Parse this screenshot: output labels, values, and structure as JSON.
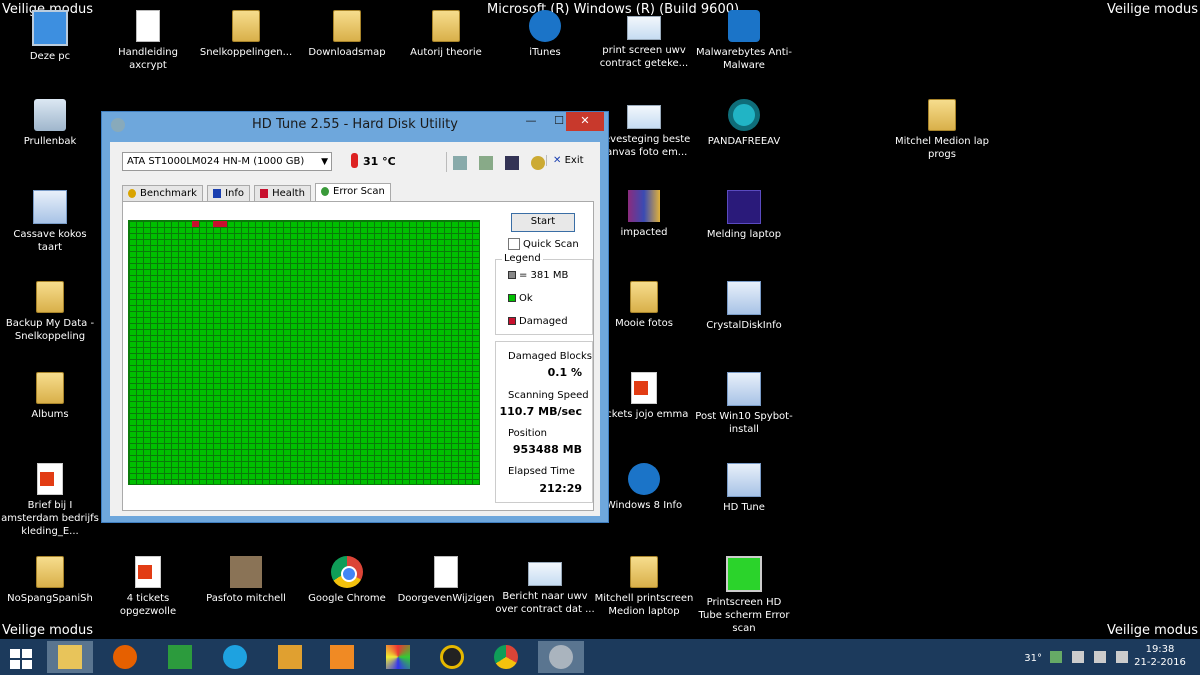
{
  "desktop": {
    "safe_mode_label": "Veilige modus",
    "build_text": "Microsoft (R) Windows (R) (Build 9600)",
    "icons": [
      {
        "label": "Deze pc",
        "icon": "pc-icon"
      },
      {
        "label": "Handleiding axcrypt",
        "icon": "document-icon"
      },
      {
        "label": "Snelkoppelingen...",
        "icon": "folder-icon"
      },
      {
        "label": "Downloadsmap",
        "icon": "folder-icon"
      },
      {
        "label": "Autorij theorie",
        "icon": "folder-icon"
      },
      {
        "label": "iTunes",
        "icon": "itunes-icon"
      },
      {
        "label": "print screen uwv contract geteke...",
        "icon": "screenshot-icon"
      },
      {
        "label": "Malwarebytes Anti-Malware",
        "icon": "malwarebytes-icon"
      },
      {
        "label": "Prullenbak",
        "icon": "recycle-bin-icon"
      },
      {
        "label": "Cassave kokos taart",
        "icon": "document-icon"
      },
      {
        "label": "Backup My Data - Snelkoppeling",
        "icon": "folder-icon"
      },
      {
        "label": "Albums",
        "icon": "folder-icon"
      },
      {
        "label": "Brief bij I amsterdam bedrijfs kleding_E...",
        "icon": "pdf-icon"
      },
      {
        "label": "bevesteging beste canvas foto em...",
        "icon": "screenshot-icon"
      },
      {
        "label": "impacted",
        "icon": "winrar-icon"
      },
      {
        "label": "Mooie fotos",
        "icon": "folder-icon"
      },
      {
        "label": "tickets jojo emma",
        "icon": "pdf-icon"
      },
      {
        "label": "Windows 8 Info",
        "icon": "info-icon"
      },
      {
        "label": "PANDAFREEAV",
        "icon": "panda-icon"
      },
      {
        "label": "Melding laptop",
        "icon": "document-icon"
      },
      {
        "label": "CrystalDiskInfo",
        "icon": "crystaldisk-icon"
      },
      {
        "label": "Post Win10 Spybot-install",
        "icon": "spybot-icon"
      },
      {
        "label": "HD Tune",
        "icon": "hdtune-icon"
      },
      {
        "label": "Mitchel Medion lap progs",
        "icon": "folder-icon"
      },
      {
        "label": "NoSpangSpaniSh",
        "icon": "folder-icon"
      },
      {
        "label": "4 tickets opgezwolle",
        "icon": "pdf-icon"
      },
      {
        "label": "Pasfoto mitchell",
        "icon": "photo-icon"
      },
      {
        "label": "Google Chrome",
        "icon": "chrome-icon"
      },
      {
        "label": "DoorgevenWijzigen",
        "icon": "document-icon"
      },
      {
        "label": "Bericht naar uwv over contract dat ...",
        "icon": "screenshot-icon"
      },
      {
        "label": "Mitchell printscreen Medion laptop",
        "icon": "folder-icon"
      },
      {
        "label": "Printscreen HD Tube scherm Error scan",
        "icon": "screenshot-icon"
      }
    ]
  },
  "window": {
    "title": "HD Tune 2.55 - Hard Disk Utility",
    "minimize_label": "—",
    "maximize_label": "☐",
    "close_label": "✕",
    "drive": "ATA    ST1000LM024 HN-M (1000 GB)",
    "temperature": "31 °C",
    "exit_label": "Exit",
    "tabs": [
      "Benchmark",
      "Info",
      "Health",
      "Error Scan"
    ],
    "active_tab": "Error Scan",
    "start_label": "Start",
    "quick_scan_label": "Quick Scan",
    "legend": {
      "title": "Legend",
      "block_size": "= 381 MB",
      "ok": "Ok",
      "damaged": "Damaged"
    },
    "stats": {
      "damaged_blocks_label": "Damaged Blocks",
      "damaged_blocks_value": "0.1 %",
      "scanning_speed_label": "Scanning Speed",
      "scanning_speed_value": "110.7 MB/sec",
      "position_label": "Position",
      "position_value": "953488 MB",
      "elapsed_time_label": "Elapsed Time",
      "elapsed_time_value": "212:29"
    },
    "colors": {
      "ok": "#00c000",
      "damaged": "#c8102e"
    }
  },
  "taskbar": {
    "apps": [
      "start-icon",
      "file-explorer-icon",
      "firefox-icon",
      "store-icon",
      "internet-explorer-icon",
      "paint-icon",
      "media-player-icon",
      "picture-app-icon",
      "disc-icon",
      "chrome-icon",
      "hdtune-icon"
    ],
    "tray_temp": "31°",
    "time": "19:38",
    "date": "21-2-2016"
  }
}
